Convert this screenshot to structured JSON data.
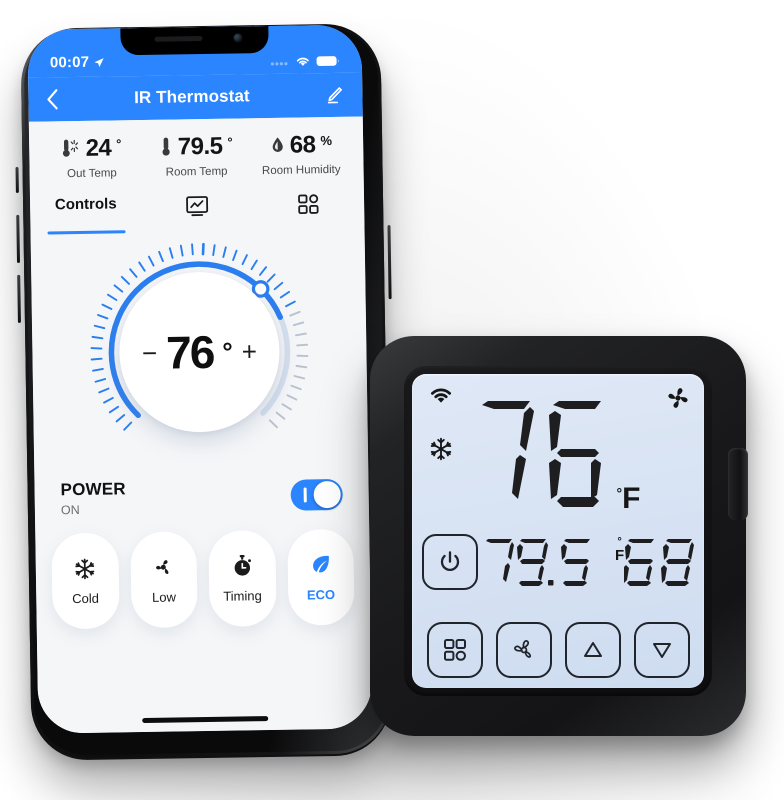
{
  "phone": {
    "status_bar": {
      "time": "00:07",
      "location_icon": "location-arrow-icon",
      "signal_icon": "signal-dots-icon",
      "wifi_icon": "wifi-icon",
      "battery_icon": "battery-full-icon"
    },
    "nav": {
      "back_icon": "chevron-left-icon",
      "title": "IR Thermostat",
      "edit_icon": "pencil-edit-icon"
    },
    "stats": [
      {
        "icon": "thermometer-sun-icon",
        "value": "24",
        "unit": "°",
        "label": "Out Temp"
      },
      {
        "icon": "thermometer-icon",
        "value": "79.5",
        "unit": "°",
        "label": "Room Temp"
      },
      {
        "icon": "humidity-drop-icon",
        "value": "68",
        "unit": "%",
        "label": "Room Humidity"
      }
    ],
    "tabs": [
      {
        "label": "Controls",
        "icon": "",
        "active": true
      },
      {
        "label": "",
        "icon": "chart-monitor-icon",
        "active": false
      },
      {
        "label": "",
        "icon": "grid-four-squares-icon",
        "active": false
      }
    ],
    "dial": {
      "minus": "−",
      "value": "76",
      "degree": "°",
      "plus": "+",
      "accent_color": "#2b7ef0",
      "track_color": "#d5dfef",
      "tick_active_color": "#2b7ef0",
      "tick_inactive_color": "#b9c2cf"
    },
    "power": {
      "title": "POWER",
      "state": "ON",
      "toggle_on": true,
      "toggle_color": "#2b85fe"
    },
    "quick_cards": [
      {
        "icon": "snowflake-icon",
        "label": "Cold",
        "active": false
      },
      {
        "icon": "fan-icon",
        "label": "Low",
        "active": false
      },
      {
        "icon": "stopwatch-icon",
        "label": "Timing",
        "active": false
      },
      {
        "icon": "leaf-icon",
        "label": "ECO",
        "active": true
      }
    ],
    "home_indicator": "home-indicator"
  },
  "device": {
    "lcd": {
      "wifi_icon": "wifi-icon",
      "snowflake_icon": "snowflake-icon",
      "fan_icon": "fan-icon",
      "setpoint": "76",
      "setpoint_degree": "°",
      "setpoint_unit": "F",
      "power_icon": "power-icon",
      "room_temp": "79.5",
      "room_temp_degree": "°",
      "room_temp_unit": "F",
      "humidity": "68",
      "humidity_unit": "%",
      "buttons": [
        {
          "icon": "grid-four-squares-icon",
          "name": "mode-button"
        },
        {
          "icon": "fan-icon",
          "name": "fan-button"
        },
        {
          "icon": "triangle-up-icon",
          "name": "up-button"
        },
        {
          "icon": "triangle-down-icon",
          "name": "down-button"
        }
      ]
    },
    "side_button": "device-side-button",
    "body_color": "#19191b",
    "lcd_color": "#d8e3f4"
  }
}
